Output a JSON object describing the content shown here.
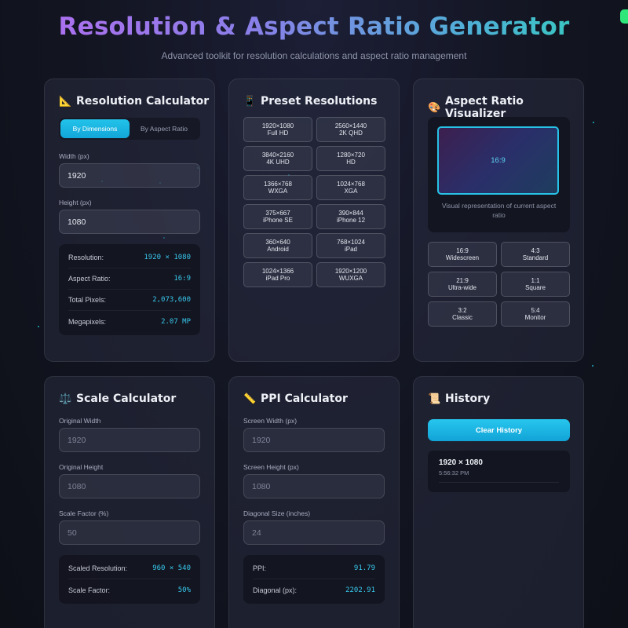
{
  "header": {
    "title": "Resolution & Aspect Ratio Generator",
    "subtitle": "Advanced toolkit for resolution calculations and aspect ratio management"
  },
  "resolution_calculator": {
    "title": "Resolution Calculator",
    "icon": "triangular-ruler-icon",
    "tabs": [
      "By Dimensions",
      "By Aspect Ratio"
    ],
    "active_tab": "By Dimensions",
    "width_label": "Width (px)",
    "width_value": "1920",
    "height_label": "Height (px)",
    "height_value": "1080",
    "results": [
      {
        "label": "Resolution:",
        "value": "1920 × 1080"
      },
      {
        "label": "Aspect Ratio:",
        "value": "16:9"
      },
      {
        "label": "Total Pixels:",
        "value": "2,073,600"
      },
      {
        "label": "Megapixels:",
        "value": "2.07 MP"
      }
    ]
  },
  "preset_resolutions": {
    "title": "Preset Resolutions",
    "icon": "mobile-phone-icon",
    "presets": [
      {
        "res": "1920×1080",
        "name": "Full HD"
      },
      {
        "res": "2560×1440",
        "name": "2K QHD"
      },
      {
        "res": "3840×2160",
        "name": "4K UHD"
      },
      {
        "res": "1280×720",
        "name": "HD"
      },
      {
        "res": "1366×768",
        "name": "WXGA"
      },
      {
        "res": "1024×768",
        "name": "XGA"
      },
      {
        "res": "375×667",
        "name": "iPhone SE"
      },
      {
        "res": "390×844",
        "name": "iPhone 12"
      },
      {
        "res": "360×640",
        "name": "Android"
      },
      {
        "res": "768×1024",
        "name": "iPad"
      },
      {
        "res": "1024×1366",
        "name": "iPad Pro"
      },
      {
        "res": "1920×1200",
        "name": "WUXGA"
      }
    ]
  },
  "aspect_visualizer": {
    "title": "Aspect Ratio Visualizer",
    "icon": "palette-icon",
    "preview_label": "16:9",
    "caption": "Visual representation of current aspect ratio",
    "ratios": [
      {
        "ratio": "16:9",
        "name": "Widescreen"
      },
      {
        "ratio": "4:3",
        "name": "Standard"
      },
      {
        "ratio": "21:9",
        "name": "Ultra-wide"
      },
      {
        "ratio": "1:1",
        "name": "Square"
      },
      {
        "ratio": "3:2",
        "name": "Classic"
      },
      {
        "ratio": "5:4",
        "name": "Monitor"
      }
    ]
  },
  "scale_calculator": {
    "title": "Scale Calculator",
    "icon": "balance-scale-icon",
    "orig_width_label": "Original Width",
    "orig_width_placeholder": "1920",
    "orig_height_label": "Original Height",
    "orig_height_placeholder": "1080",
    "factor_label": "Scale Factor (%)",
    "factor_placeholder": "50",
    "results": [
      {
        "label": "Scaled Resolution:",
        "value": "960 × 540"
      },
      {
        "label": "Scale Factor:",
        "value": "50%"
      }
    ]
  },
  "ppi_calculator": {
    "title": "PPI Calculator",
    "icon": "ruler-icon",
    "width_label": "Screen Width (px)",
    "width_placeholder": "1920",
    "height_label": "Screen Height (px)",
    "height_placeholder": "1080",
    "diag_label": "Diagonal Size (inches)",
    "diag_placeholder": "24",
    "results": [
      {
        "label": "PPI:",
        "value": "91.79"
      },
      {
        "label": "Diagonal (px):",
        "value": "2202.91"
      }
    ]
  },
  "history": {
    "title": "History",
    "icon": "scroll-icon",
    "clear_label": "Clear History",
    "entries": [
      {
        "resolution": "1920 × 1080",
        "time": "5:56:32 PM"
      }
    ]
  },
  "colors": {
    "accent": "#22c3ea",
    "value_text": "#38c8ec",
    "status_indicator": "#2ee67a"
  }
}
